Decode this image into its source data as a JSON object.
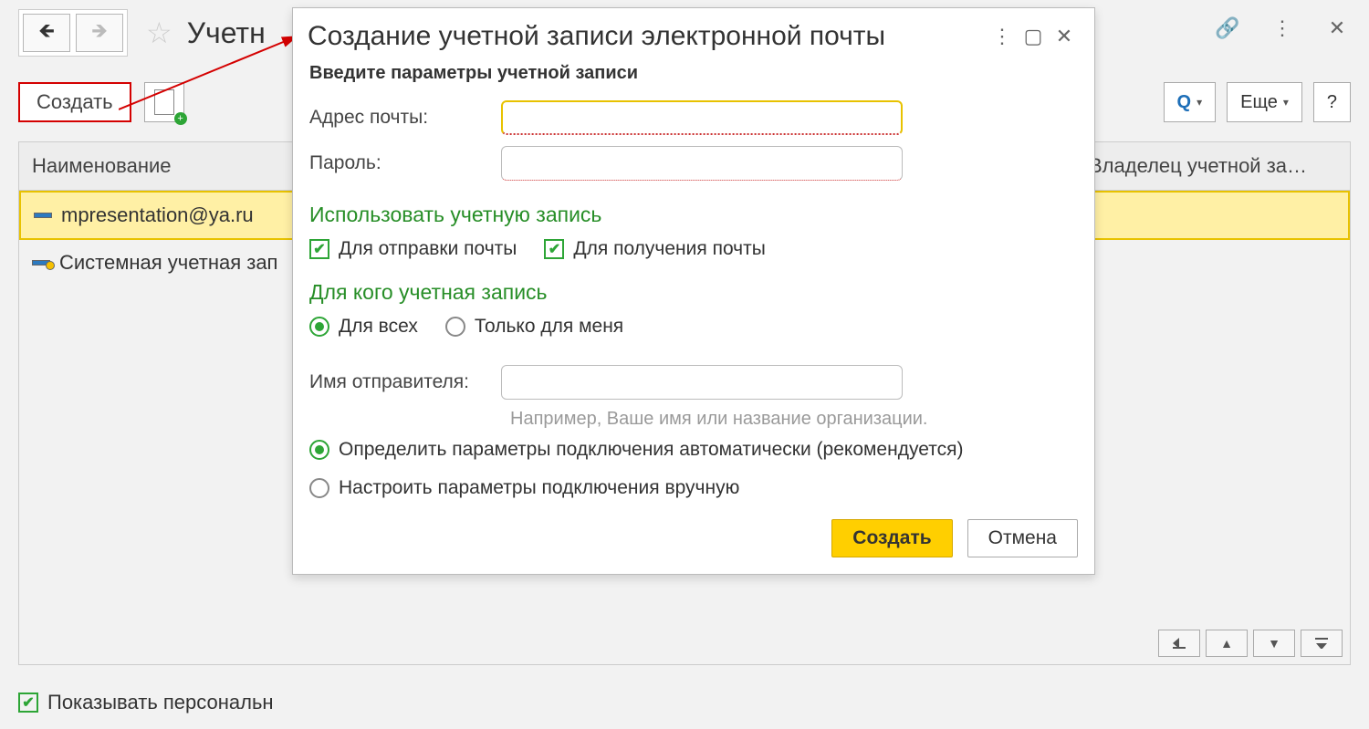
{
  "page": {
    "title_partial": "Учетн"
  },
  "toolbar": {
    "create_label": "Создать",
    "search_label": "",
    "more_label": "Еще",
    "help_label": "?"
  },
  "grid": {
    "col_name": "Наименование",
    "col_owner": "Владелец учетной за…",
    "rows": [
      {
        "label": "mpresentation@ya.ru",
        "selected": true,
        "sys": false
      },
      {
        "label": "Системная учетная зап",
        "selected": false,
        "sys": true
      }
    ]
  },
  "bottom": {
    "show_personal": "Показывать персональн"
  },
  "dialog": {
    "title": "Создание учетной записи электронной почты",
    "subtitle": "Введите параметры учетной записи",
    "fld_email": "Адрес почты:",
    "fld_password": "Пароль:",
    "section_use": "Использовать учетную запись",
    "chk_send": "Для отправки почты",
    "chk_recv": "Для получения почты",
    "section_for": "Для кого учетная запись",
    "rad_all": "Для всех",
    "rad_me": "Только для меня",
    "fld_sender": "Имя отправителя:",
    "sender_hint": "Например, Ваше имя или название организации.",
    "rad_auto": "Определить параметры подключения автоматически (рекомендуется)",
    "rad_manual": "Настроить параметры подключения вручную",
    "btn_create": "Создать",
    "btn_cancel": "Отмена"
  }
}
